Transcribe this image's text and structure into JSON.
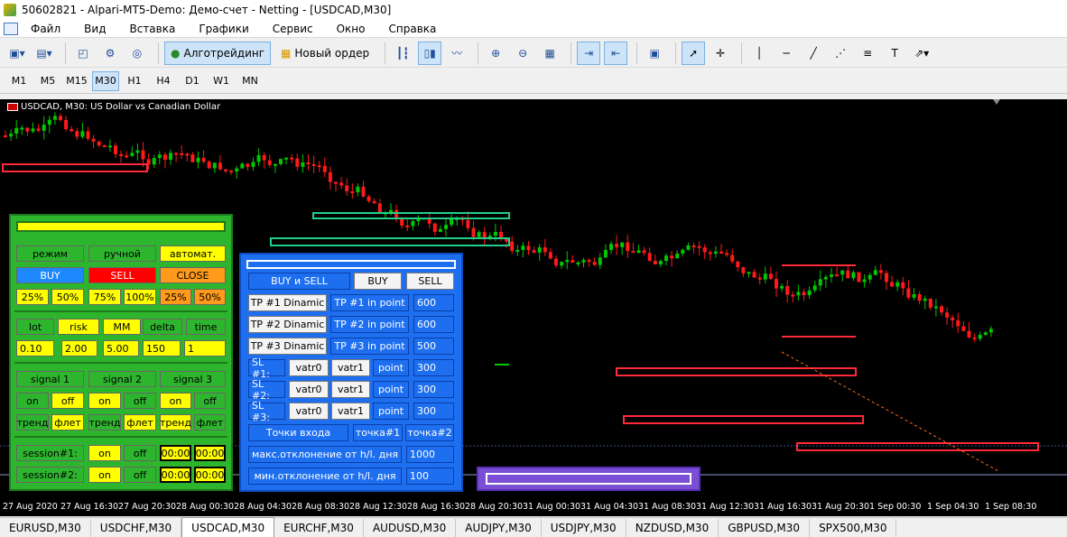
{
  "title": "50602821 - Alpari-MT5-Demo: Демо-счет - Netting - [USDCAD,M30]",
  "menu": [
    "Файл",
    "Вид",
    "Вставка",
    "Графики",
    "Сервис",
    "Окно",
    "Справка"
  ],
  "toolbar": {
    "algo": "Алготрейдинг",
    "neworder": "Новый ордер"
  },
  "timeframes": [
    "M1",
    "M5",
    "M15",
    "M30",
    "H1",
    "H4",
    "D1",
    "W1",
    "MN"
  ],
  "active_tf": "M30",
  "chart_title": "USDCAD, M30:  US Dollar vs Canadian Dollar",
  "xaxis": [
    "27 Aug 2020",
    "27 Aug 16:30",
    "27 Aug 20:30",
    "28 Aug 00:30",
    "28 Aug 04:30",
    "28 Aug 08:30",
    "28 Aug 12:30",
    "28 Aug 16:30",
    "28 Aug 20:30",
    "31 Aug 00:30",
    "31 Aug 04:30",
    "31 Aug 08:30",
    "31 Aug 12:30",
    "31 Aug 16:30",
    "31 Aug 20:30",
    "1 Sep 00:30",
    "1 Sep 04:30",
    "1 Sep 08:30"
  ],
  "tabs": [
    "EURUSD,M30",
    "USDCHF,M30",
    "USDCAD,M30",
    "EURCHF,M30",
    "AUDUSD,M30",
    "AUDJPY,M30",
    "USDJPY,M30",
    "NZDUSD,M30",
    "GBPUSD,M30",
    "SPX500,M30"
  ],
  "active_tab": "USDCAD,M30",
  "green_panel": {
    "mode": "режим",
    "manual": "ручной",
    "auto": "автомат.",
    "buy": "BUY",
    "sell": "SELL",
    "close": "CLOSE",
    "pcts": [
      "25%",
      "50%",
      "75%",
      "100%",
      "25%",
      "50%"
    ],
    "params": [
      "lot",
      "risk",
      "MM",
      "delta",
      "time"
    ],
    "values": [
      "0.10",
      "2.00",
      "5.00",
      "150",
      "1"
    ],
    "signals": [
      "signal 1",
      "signal 2",
      "signal 3"
    ],
    "on": "on",
    "off": "off",
    "trend": "тренд",
    "flat": "флет",
    "session1": "session#1:",
    "session2": "session#2:",
    "time0": "00:00"
  },
  "blue_panel": {
    "buysell": "BUY и SELL",
    "buy": "BUY",
    "sell": "SELL",
    "tp": [
      {
        "l": "TP #1 Dinamic",
        "r": "TP #1 in point",
        "v": "600"
      },
      {
        "l": "TP #2 Dinamic",
        "r": "TP #2 in point",
        "v": "600"
      },
      {
        "l": "TP #3 Dinamic",
        "r": "TP #3 in point",
        "v": "500"
      }
    ],
    "sl": [
      {
        "l": "SL #1:",
        "v": "300"
      },
      {
        "l": "SL #2:",
        "v": "300"
      },
      {
        "l": "SL #3:",
        "v": "300"
      }
    ],
    "vatr0": "vatr0",
    "vatr1": "vatr1",
    "point": "point",
    "entry": "Точки входа",
    "p1": "точка#1",
    "p2": "точка#2",
    "maxdev": "макс.отклонение от h/l. дня",
    "maxv": "1000",
    "mindev": "мин.отклонение от h/l. дня",
    "minv": "100"
  }
}
